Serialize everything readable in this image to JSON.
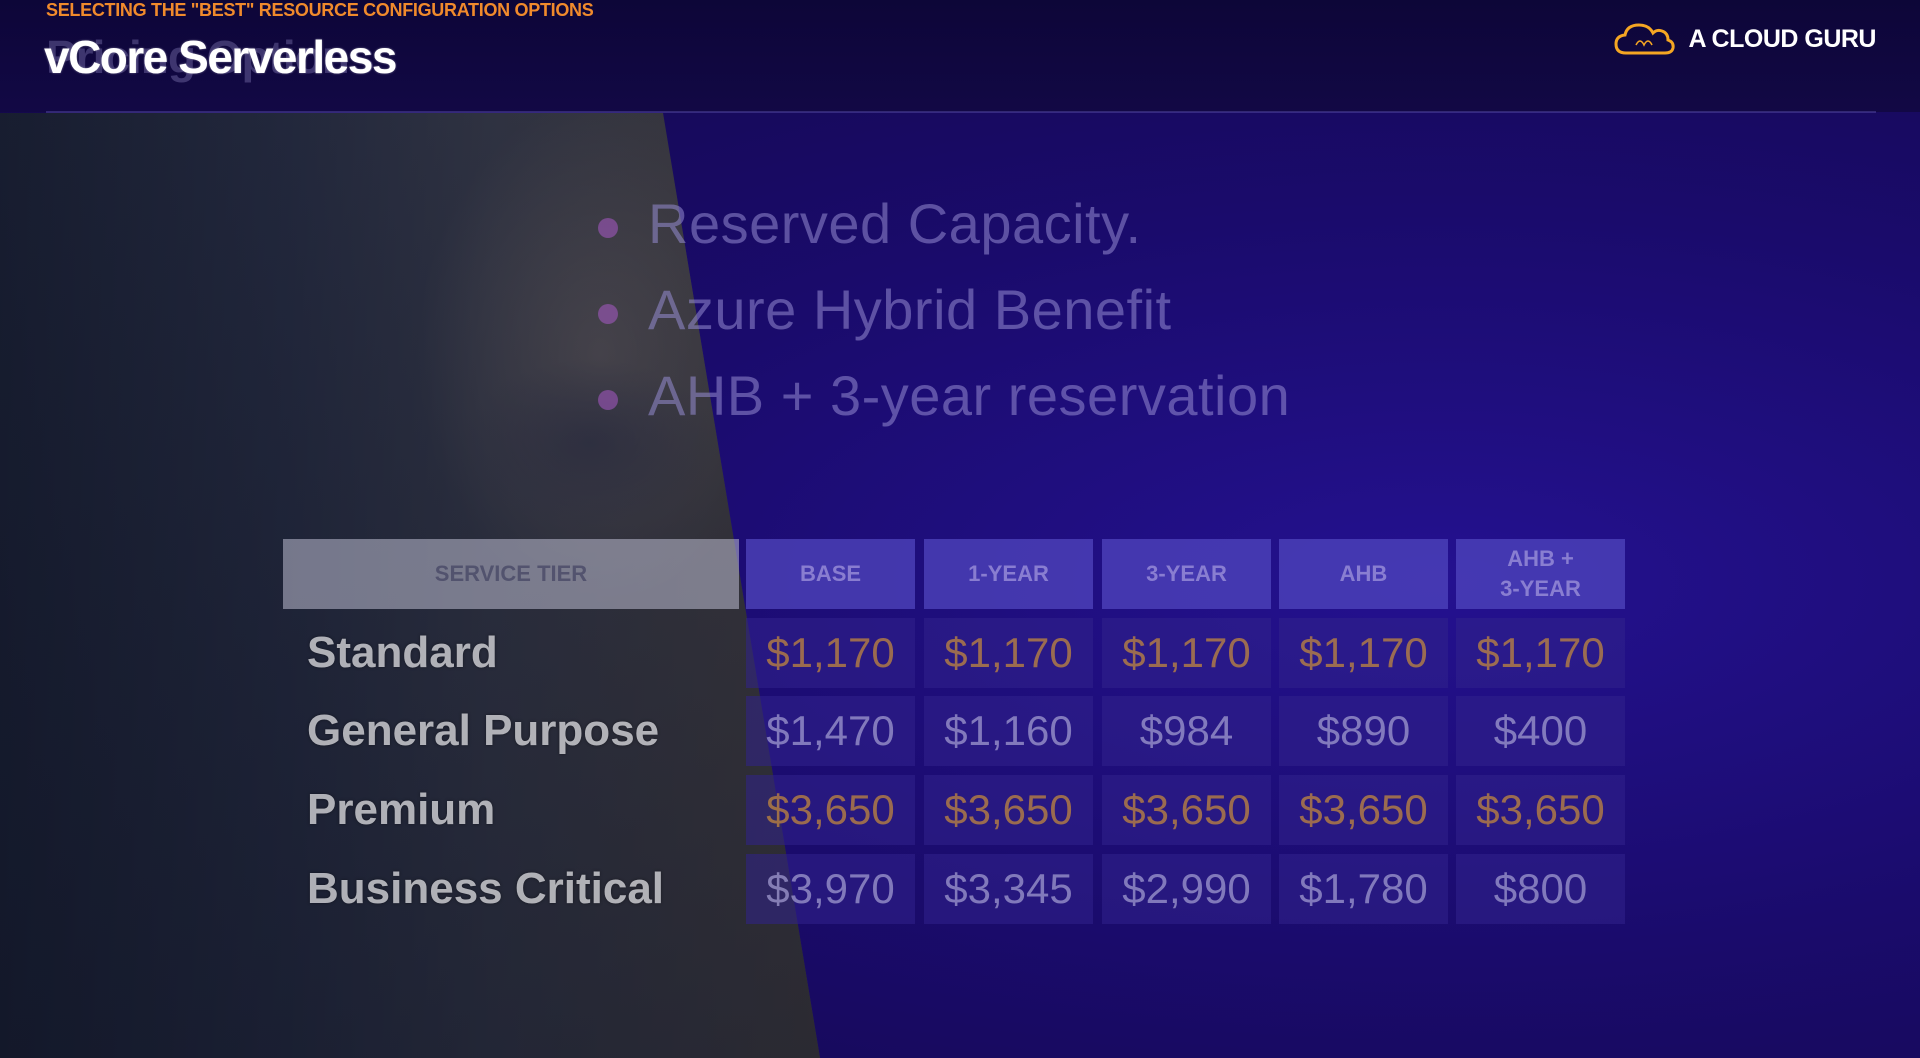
{
  "header": {
    "kicker": "SELECTING THE \"BEST\" RESOURCE CONFIGURATION OPTIONS",
    "title": "vCore Serverless",
    "title_ghost": "Pricing Options",
    "brand": "A CLOUD GURU"
  },
  "bullets": [
    "Reserved Capacity.",
    "Azure Hybrid Benefit",
    "AHB + 3-year reservation"
  ],
  "table": {
    "tier_header": "SERVICE TIER",
    "columns": [
      "BASE",
      "1-YEAR",
      "3-YEAR",
      "AHB",
      "AHB +\n3-YEAR"
    ],
    "rows": [
      {
        "label": "Standard",
        "values": [
          "$1,170",
          "$1,170",
          "$1,170",
          "$1,170",
          "$1,170"
        ],
        "highlight": true
      },
      {
        "label": "General Purpose",
        "values": [
          "$1,470",
          "$1,160",
          "$984",
          "$890",
          "$400"
        ],
        "highlight": false
      },
      {
        "label": "Premium",
        "values": [
          "$3,650",
          "$3,650",
          "$3,650",
          "$3,650",
          "$3,650"
        ],
        "highlight": true
      },
      {
        "label": "Business Critical",
        "values": [
          "$3,970",
          "$3,345",
          "$2,990",
          "$1,780",
          "$800"
        ],
        "highlight": false
      }
    ]
  },
  "colors": {
    "accent": "#f08a2c",
    "background": "#1a0b6c",
    "highlight_value": "#c88c3c"
  }
}
